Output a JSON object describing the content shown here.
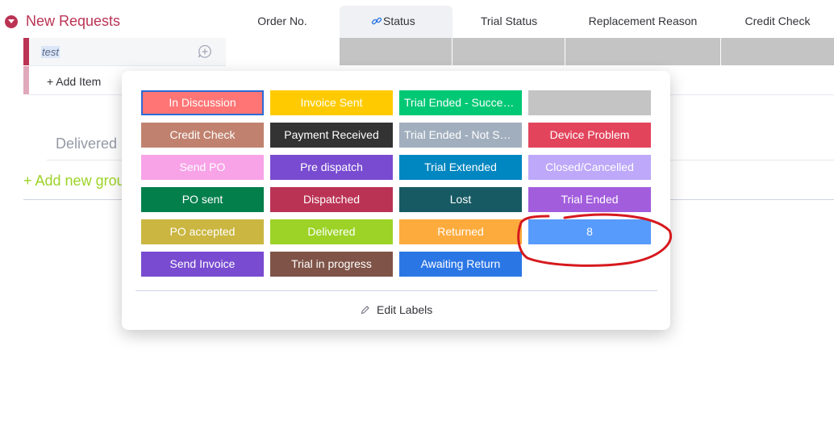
{
  "group": {
    "title": "New Requests",
    "color": "#bb3354",
    "columns": [
      "Order No.",
      "Status",
      "Trial Status",
      "Replacement Reason",
      "Credit Check"
    ]
  },
  "row": {
    "name": "test"
  },
  "add_item": "+ Add Item",
  "other_group": {
    "title": "Delivered"
  },
  "add_new_group": "+ Add new grou",
  "popup": {
    "labels": [
      {
        "text": "In Discussion",
        "color": "#ff7575"
      },
      {
        "text": "Invoice Sent",
        "color": "#ffcb00"
      },
      {
        "text": "Trial Ended - Successful",
        "color": "#00c875"
      },
      {
        "text": "",
        "color": "#c4c4c4"
      },
      {
        "text": "Credit Check",
        "color": "#c0826f"
      },
      {
        "text": "Payment Received",
        "color": "#333333"
      },
      {
        "text": "Trial Ended - Not Successful",
        "color": "#a1aebd"
      },
      {
        "text": "Device Problem",
        "color": "#e2445c"
      },
      {
        "text": "Send PO",
        "color": "#f8a3e8"
      },
      {
        "text": "Pre dispatch",
        "color": "#784bd1"
      },
      {
        "text": "Trial Extended",
        "color": "#0086c0"
      },
      {
        "text": "Closed/Cancelled",
        "color": "#bda8f9"
      },
      {
        "text": "PO sent",
        "color": "#037f4c"
      },
      {
        "text": "Dispatched",
        "color": "#bb3354"
      },
      {
        "text": "Lost",
        "color": "#175a63"
      },
      {
        "text": "Trial Ended",
        "color": "#a25ddc"
      },
      {
        "text": "PO accepted",
        "color": "#cab641"
      },
      {
        "text": "Delivered",
        "color": "#9cd326"
      },
      {
        "text": "Returned",
        "color": "#fdab3d"
      },
      {
        "text": "8",
        "color": "#579bfc"
      },
      {
        "text": "Send Invoice",
        "color": "#784bd1"
      },
      {
        "text": "Trial in progress",
        "color": "#7f5347"
      },
      {
        "text": "Awaiting Return",
        "color": "#2b76e5"
      }
    ],
    "edit_labels": "Edit Labels"
  }
}
